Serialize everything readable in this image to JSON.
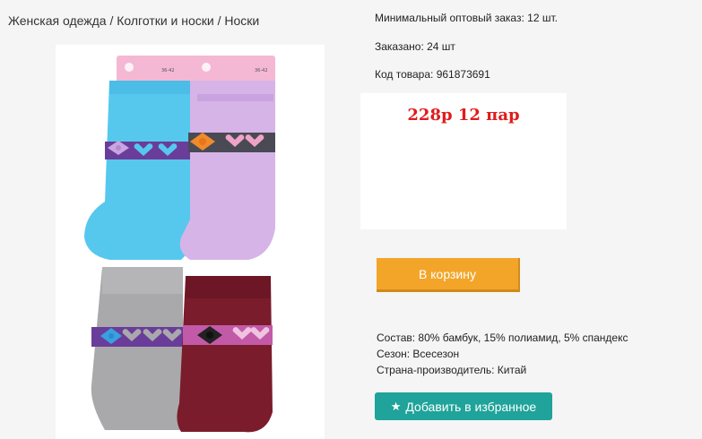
{
  "breadcrumb": {
    "item1": "Женская одежда",
    "sep1": " / ",
    "item2": "Колготки и носки",
    "sep2": " / ",
    "item3": "Носки"
  },
  "product": {
    "min_order": "Минимальный оптовый заказ: 12 шт.",
    "ordered": "Заказано: 24 шт",
    "sku": "Код товара: 961873691",
    "price": "228р 12 пар",
    "cart_button": "В корзину",
    "composition": "Состав: 80% бамбук, 15% полиамид, 5% спандекс",
    "season": "Сезон: Всесезон",
    "country": "Страна-производитель: Китай",
    "favorite_button": "Добавить в избранное",
    "favorite_icon": "star-icon"
  },
  "image": {
    "tag_size_1": "36-42",
    "tag_size_2": "36-42"
  },
  "colors": {
    "price": "#e01b1b",
    "cart_button": "#f3a52a",
    "favorite_button": "#1fa39a",
    "sock_blue": "#56c8ee",
    "sock_lilac": "#d6b4e8",
    "sock_grey": "#a9a9ab",
    "sock_burgundy": "#7a1c2c"
  }
}
